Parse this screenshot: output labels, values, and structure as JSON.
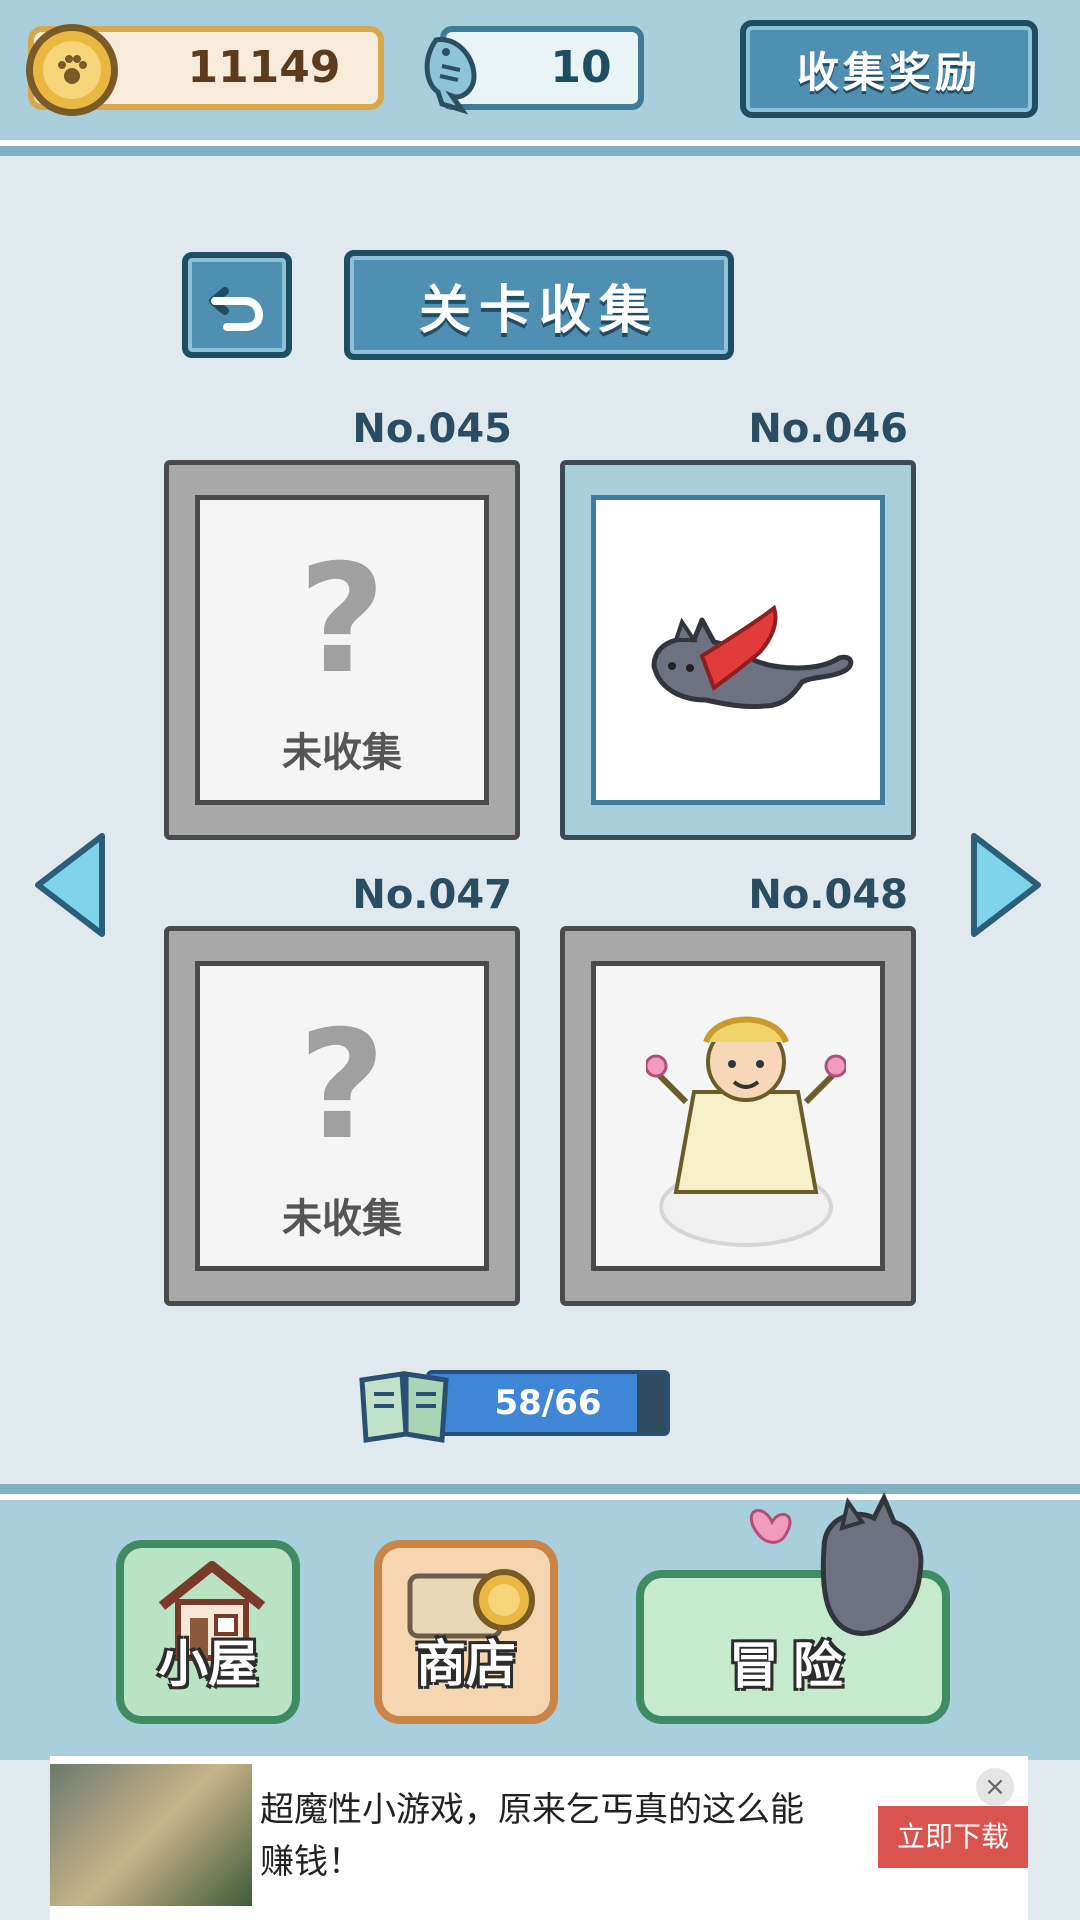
{
  "topbar": {
    "coins": "11149",
    "fish": "10",
    "reward_label": "收集奖励"
  },
  "title": {
    "label": "关卡收集"
  },
  "cards": [
    {
      "number": "No.045",
      "status": "未收集",
      "collected": false
    },
    {
      "number": "No.046",
      "status": "",
      "collected": true,
      "art": "flying-cat-cape"
    },
    {
      "number": "No.047",
      "status": "未收集",
      "collected": false
    },
    {
      "number": "No.048",
      "status": "",
      "collected": true,
      "art": "monkey-king-on-cloud"
    }
  ],
  "progress": {
    "text": "58/66",
    "collected": 58,
    "total": 66
  },
  "nav": {
    "house": "小屋",
    "shop": "商店",
    "adventure": "冒险"
  },
  "ad": {
    "text": "超魔性小游戏，原来乞丐真的这么能赚钱！",
    "button": "立即下载"
  },
  "colors": {
    "accent_blue": "#4f8fb1",
    "dark_blue": "#1f4e63",
    "progress_fill": "#3f86d6"
  }
}
